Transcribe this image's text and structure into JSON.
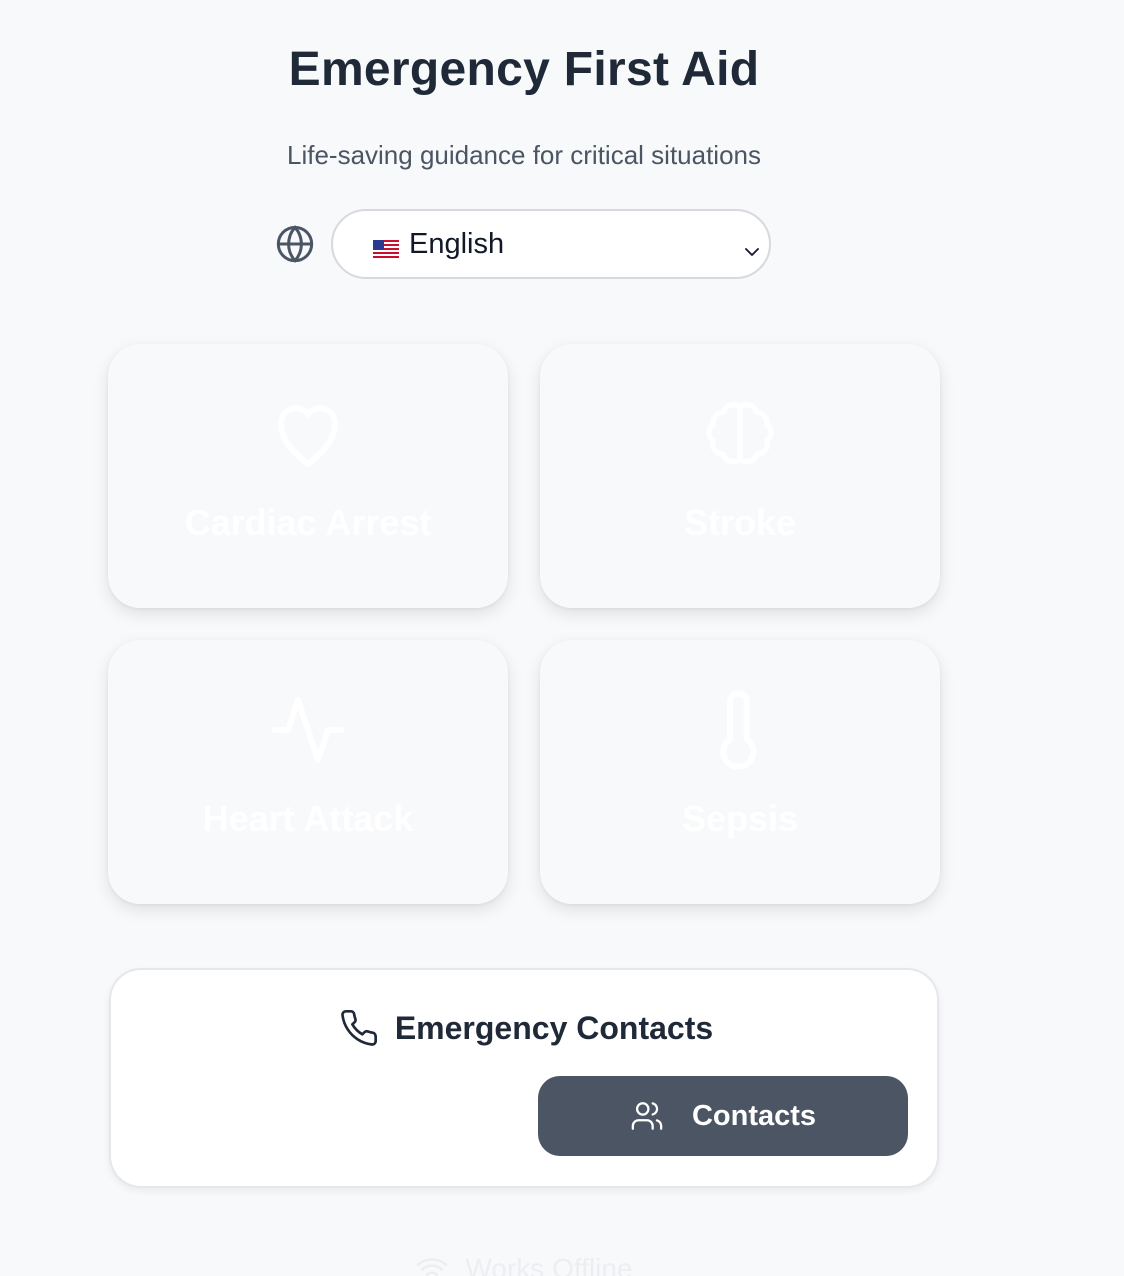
{
  "header": {
    "title": "Emergency First Aid",
    "subtitle": "Life-saving guidance for critical situations"
  },
  "language": {
    "icon": "globe-icon",
    "flag": "us-flag",
    "selected": "English"
  },
  "conditions": [
    {
      "label": "Cardiac Arrest",
      "icon": "heart-icon"
    },
    {
      "label": "Stroke",
      "icon": "brain-icon"
    },
    {
      "label": "Heart Attack",
      "icon": "pulse-icon"
    },
    {
      "label": "Sepsis",
      "icon": "thermometer-icon"
    }
  ],
  "contacts": {
    "heading": "Emergency Contacts",
    "heading_icon": "phone-icon",
    "button_label": "Contacts",
    "button_icon": "users-icon"
  },
  "footer": {
    "offline_label": "Works Offline",
    "offline_icon": "wifi-icon"
  },
  "colors": {
    "background": "#f7f9fb",
    "text": "#1f2937",
    "muted": "#4b5563",
    "button": "#4b5563"
  }
}
